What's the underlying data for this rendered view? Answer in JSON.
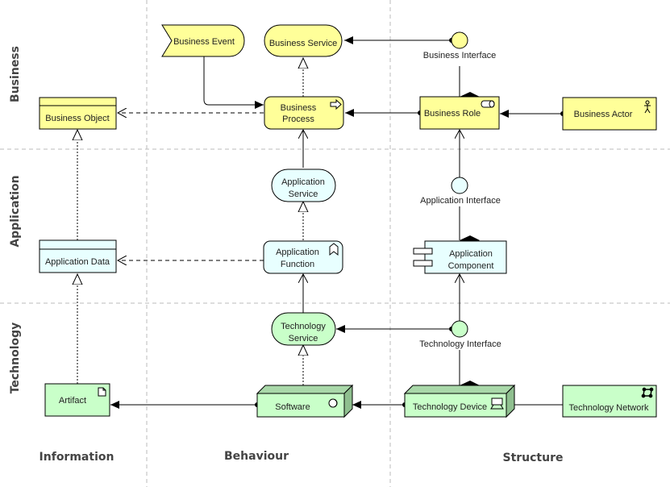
{
  "colors": {
    "business": "#ffff99",
    "application": "#e8ffff",
    "technology": "#c9ffc9",
    "technology_dark": "#a9d8a9",
    "technology_darker": "#8fbf8f",
    "stroke": "#000000",
    "grid": "#bbbbbb"
  },
  "lanes": {
    "business": "Business",
    "application": "Application",
    "technology": "Technology"
  },
  "columns": {
    "information": "Information",
    "behaviour": "Behaviour",
    "structure": "Structure"
  },
  "elements": {
    "business_event": {
      "label": "Business Event"
    },
    "business_service": {
      "label": "Business Service"
    },
    "business_interface": {
      "label": "Business Interface"
    },
    "business_object": {
      "label": "Business Object"
    },
    "business_process": {
      "line1": "Business",
      "line2": "Process"
    },
    "business_role": {
      "label": "Business Role"
    },
    "business_actor": {
      "label": "Business Actor"
    },
    "application_service": {
      "line1": "Application",
      "line2": "Service"
    },
    "application_interface": {
      "label": "Application Interface"
    },
    "application_data": {
      "label": "Application Data"
    },
    "application_function": {
      "line1": "Application",
      "line2": "Function"
    },
    "application_component": {
      "line1": "Application",
      "line2": "Component"
    },
    "technology_service": {
      "line1": "Technology",
      "line2": "Service"
    },
    "technology_interface": {
      "label": "Technology Interface"
    },
    "artifact": {
      "label": "Artifact"
    },
    "software": {
      "label": "Software"
    },
    "technology_device": {
      "label": "Technology Device"
    },
    "technology_network": {
      "label": "Technology Network"
    }
  }
}
